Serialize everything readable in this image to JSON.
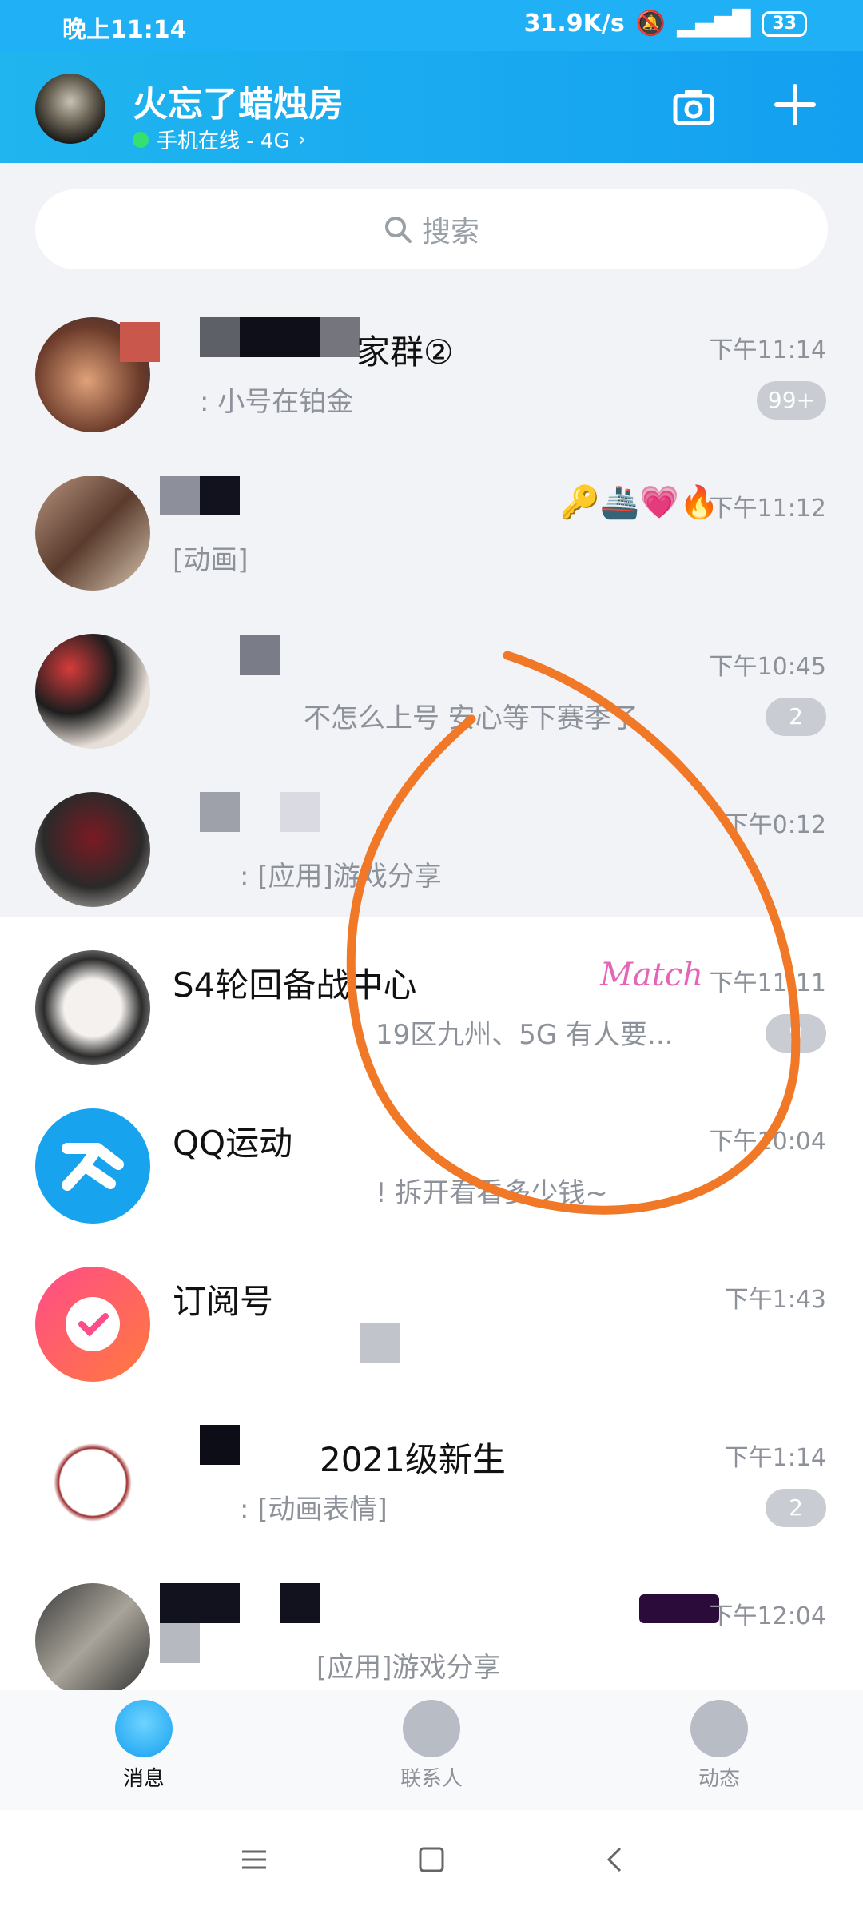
{
  "status": {
    "time": "晚上11:14",
    "speed": "31.9K/s",
    "battery": "33"
  },
  "header": {
    "title": "火忘了蜡烛房",
    "status": "手机在线 - 4G"
  },
  "search": {
    "placeholder": "搜索"
  },
  "chats": [
    {
      "name": "家群②",
      "msg": ": 小号在铂金",
      "time": "下午11:14",
      "badge": "99+"
    },
    {
      "name": "",
      "msg": "[动画]",
      "time": "下午11:12",
      "badge": ""
    },
    {
      "name": "",
      "msg": "不怎么上号 安心等下赛季了",
      "time": "下午10:45",
      "badge": "2"
    },
    {
      "name": "",
      "msg": ": [应用]游戏分享",
      "time": "下午0:12",
      "badge": ""
    },
    {
      "name": "S4轮回备战中心",
      "msg": "19区九州、5G 有人要...",
      "time": "下午11:11",
      "badge": "9"
    },
    {
      "name": "QQ运动",
      "msg": "! 拆开看看多少钱~",
      "time": "下午10:04",
      "badge": ""
    },
    {
      "name": "订阅号",
      "msg": "",
      "time": "下午1:43",
      "badge": ""
    },
    {
      "name": "2021级新生",
      "msg": ": [动画表情]",
      "time": "下午1:14",
      "badge": "2"
    },
    {
      "name": "",
      "msg": "[应用]游戏分享",
      "time": "下午12:04",
      "badge": ""
    }
  ],
  "tabs": {
    "messages": "消息",
    "contacts": "联系人",
    "moments": "动态"
  },
  "decor": {
    "match_sticker": "Match"
  },
  "colors": {
    "accent": "#13a0f0",
    "annotation": "#f07826"
  }
}
